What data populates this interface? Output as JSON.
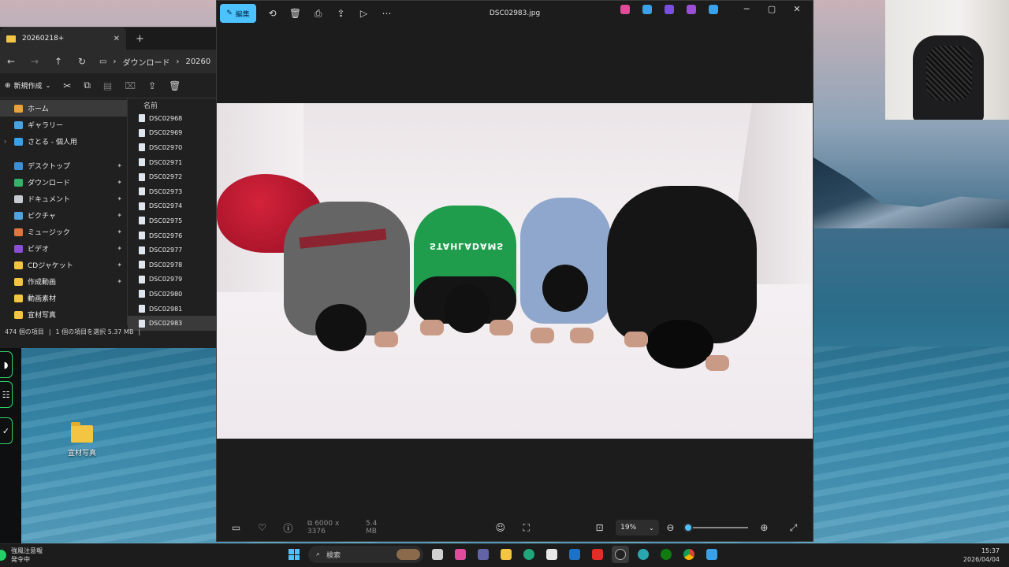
{
  "explorer": {
    "tab_title": "20260218+",
    "breadcrumb": [
      "ダウンロード",
      "20260"
    ],
    "new_label": "新規作成",
    "nav_items": [
      {
        "label": "ホーム",
        "selected": true,
        "pinned": false,
        "color": "#e8a33c"
      },
      {
        "label": "ギャラリー",
        "selected": false,
        "pinned": false,
        "color": "#4aa3df"
      },
      {
        "label": "さとる - 個人用",
        "selected": false,
        "pinned": false,
        "color": "#3aa0e8",
        "expandable": true
      },
      {
        "label": "デスクトップ",
        "selected": false,
        "pinned": true,
        "color": "#3d8fd6"
      },
      {
        "label": "ダウンロード",
        "selected": false,
        "pinned": true,
        "color": "#35b36a"
      },
      {
        "label": "ドキュメント",
        "selected": false,
        "pinned": true,
        "color": "#c6cbd2"
      },
      {
        "label": "ピクチャ",
        "selected": false,
        "pinned": true,
        "color": "#4fa4e0"
      },
      {
        "label": "ミュージック",
        "selected": false,
        "pinned": true,
        "color": "#e0763c"
      },
      {
        "label": "ビデオ",
        "selected": false,
        "pinned": true,
        "color": "#8a4fd6"
      },
      {
        "label": "CDジャケット",
        "selected": false,
        "pinned": true,
        "color": "#f4c542"
      },
      {
        "label": "作成動画",
        "selected": false,
        "pinned": true,
        "color": "#f4c542"
      },
      {
        "label": "動画素材",
        "selected": false,
        "pinned": false,
        "color": "#f4c542"
      },
      {
        "label": "宣材写真",
        "selected": false,
        "pinned": false,
        "color": "#f4c542"
      }
    ],
    "column_header": "名前",
    "files": [
      "DSC02968",
      "DSC02969",
      "DSC02970",
      "DSC02971",
      "DSC02972",
      "DSC02973",
      "DSC02974",
      "DSC02975",
      "DSC02976",
      "DSC02977",
      "DSC02978",
      "DSC02979",
      "DSC02980",
      "DSC02981",
      "DSC02983"
    ],
    "selected_file": "DSC02983",
    "status_count": "474 個の項目",
    "status_selection": "1 個の項目を選択 5.37 MB"
  },
  "viewer": {
    "edit_label": "編集",
    "file_title": "DSC02983.jpg",
    "dimensions": "6000 x 3376",
    "file_size": "5.4 MB",
    "zoom_level": "19%",
    "zoom_fraction": 0.03,
    "photo_shirt_text": "STAHLADAMS",
    "app_colors": [
      "#e04b9a",
      "#3aa0e8",
      "#7a4fe0",
      "#9b4fd6",
      "#3aa0e8"
    ]
  },
  "desktop": {
    "folder_label": "宣材写真"
  },
  "taskbar": {
    "news_line1": "強風注意報",
    "news_line2": "発令中",
    "search_placeholder": "検索",
    "time": "15:37",
    "date": "2026/04/04"
  },
  "colors": {
    "accent": "#4cc2ff",
    "photo_bg": "#f2eef0"
  }
}
